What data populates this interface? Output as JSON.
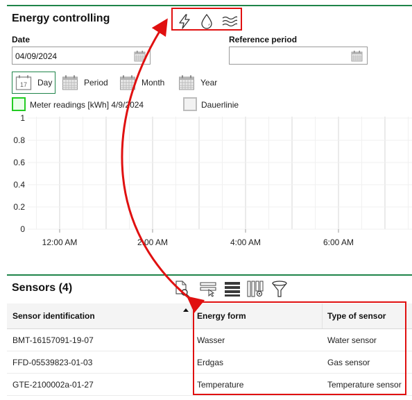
{
  "energy_controlling": {
    "title": "Energy controlling",
    "energy_icons": [
      "electricity-icon",
      "water-drop-icon",
      "heat-waves-icon"
    ],
    "date": {
      "label": "Date",
      "value": "04/09/2024"
    },
    "reference_period": {
      "label": "Reference period",
      "value": ""
    },
    "period_buttons": [
      {
        "label": "Day",
        "icon": "calendar-day-icon",
        "active": true,
        "day_number": "17"
      },
      {
        "label": "Period",
        "icon": "calendar-icon",
        "active": false
      },
      {
        "label": "Month",
        "icon": "calendar-icon",
        "active": false
      },
      {
        "label": "Year",
        "icon": "calendar-icon",
        "active": false
      }
    ],
    "legend": [
      {
        "label": "Meter readings [kWh] 4/9/2024",
        "color": "#22cc22",
        "fill": "#eaffea"
      },
      {
        "label": "Dauerlinie",
        "color": "#bdbdbd",
        "fill": "#f2f2f2"
      }
    ]
  },
  "chart_data": {
    "type": "line",
    "title": "",
    "xlabel": "",
    "ylabel": "",
    "series": [
      {
        "name": "Meter readings [kWh] 4/9/2024",
        "values": []
      },
      {
        "name": "Dauerlinie",
        "values": []
      }
    ],
    "y_ticks": [
      "0",
      "0.2",
      "0.4",
      "0.6",
      "0.8",
      "1"
    ],
    "ylim": [
      0,
      1
    ],
    "x_ticks": [
      "12:00 AM",
      "2:00 AM",
      "4:00 AM",
      "6:00 AM"
    ],
    "grid": true,
    "legend_position": "top-left"
  },
  "sensors": {
    "title": "Sensors (4)",
    "toolbar": [
      "document-search-icon",
      "row-select-icon",
      "rows-icon",
      "column-settings-icon",
      "filter-icon"
    ],
    "columns": [
      "Sensor identification",
      "Energy form",
      "Type of sensor"
    ],
    "sort_column": "Sensor identification",
    "sort_direction": "ascending",
    "rows": [
      {
        "id": "BMT-16157091-19-07",
        "energy_form": "Wasser",
        "type": "Water sensor"
      },
      {
        "id": "FFD-05539823-01-03",
        "energy_form": "Erdgas",
        "type": "Gas sensor"
      },
      {
        "id": "GTE-2100002a-01-27",
        "energy_form": "Temperature",
        "type": "Temperature sensor"
      }
    ]
  },
  "annotation_color": "#e01010"
}
